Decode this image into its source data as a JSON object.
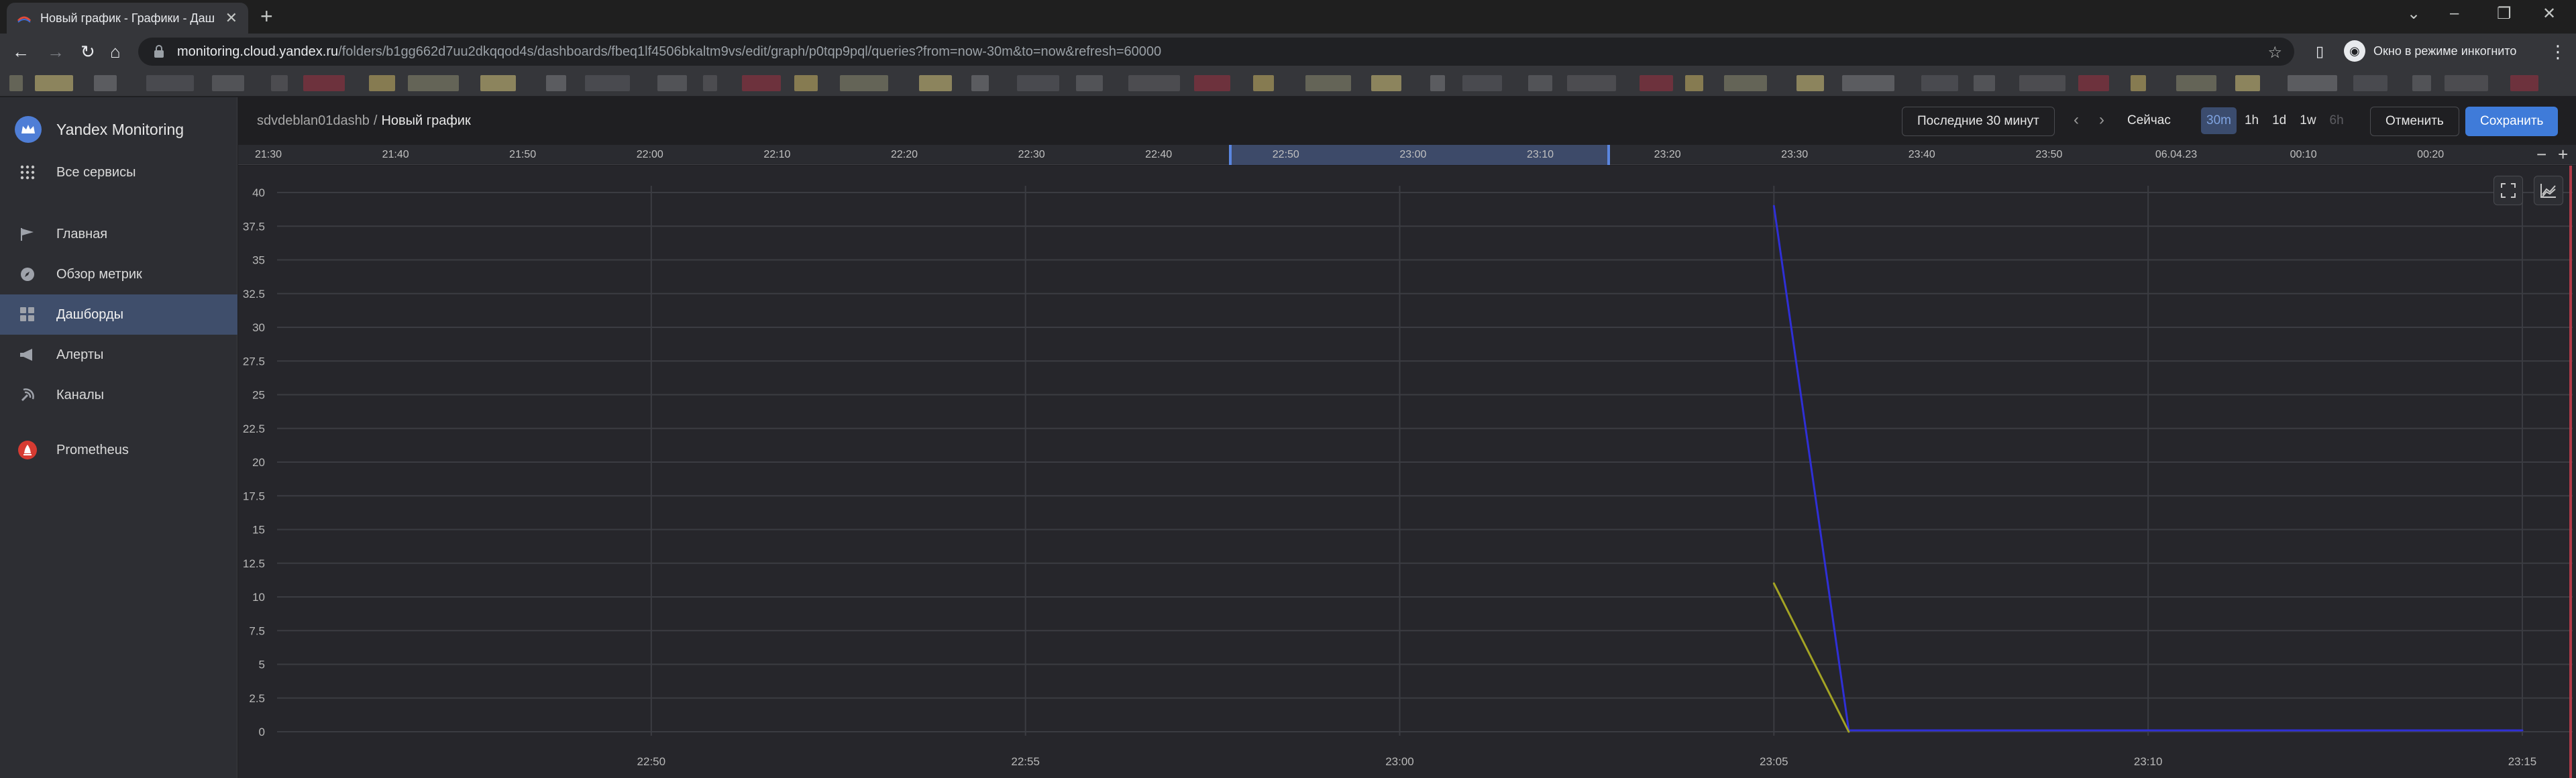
{
  "browser": {
    "tab_title": "Новый график - Графики - Даш",
    "url_host": "monitoring.cloud.yandex.ru",
    "url_path": "/folders/b1gg662d7uu2dkqqod4s/dashboards/fbeq1lf4506bkaltm9vs/edit/graph/p0tqp9pql/queries?from=now-30m&to=now&refresh=60000",
    "incognito_label": "Окно в режиме инкогнито"
  },
  "sidebar": {
    "brand": "Yandex Monitoring",
    "all_services": "Все сервисы",
    "items": [
      {
        "label": "Главная",
        "icon": "flag-icon"
      },
      {
        "label": "Обзор метрик",
        "icon": "compass-icon"
      },
      {
        "label": "Дашборды",
        "icon": "dashboard-icon",
        "active": true
      },
      {
        "label": "Алерты",
        "icon": "megaphone-icon"
      },
      {
        "label": "Каналы",
        "icon": "channels-icon"
      }
    ],
    "prometheus": "Prometheus"
  },
  "header": {
    "breadcrumb_parent": "sdvdeblan01dashb",
    "breadcrumb_sep": "/",
    "breadcrumb_current": "Новый график",
    "time_range": "Последние 30 минут",
    "now_button": "Сейчас",
    "scales": [
      "30m",
      "1h",
      "1d",
      "1w",
      "6h"
    ],
    "selected_scale": "30m",
    "cancel_button": "Отменить",
    "save_button": "Сохранить"
  },
  "timenav": {
    "ticks": [
      "21:30",
      "21:40",
      "21:50",
      "22:00",
      "22:10",
      "22:20",
      "22:30",
      "22:40",
      "22:50",
      "23:00",
      "23:10",
      "23:20",
      "23:30",
      "23:40",
      "23:50",
      "06.04.23",
      "00:10",
      "00:20"
    ],
    "zoom_out": "−",
    "zoom_in": "+"
  },
  "chart_data": {
    "type": "line",
    "x_ticks": [
      "22:50",
      "22:55",
      "23:00",
      "23:05",
      "23:10",
      "23:15"
    ],
    "y_ticks": [
      "0",
      "2.5",
      "5",
      "7.5",
      "10",
      "12.5",
      "15",
      "17.5",
      "20",
      "22.5",
      "25",
      "27.5",
      "30",
      "32.5",
      "35",
      "37.5",
      "40"
    ],
    "ylim": [
      0,
      40
    ],
    "grid": true,
    "series": [
      {
        "color": "#2f2fd6",
        "x": [
          "23:05",
          "23:06",
          "23:10",
          "23:15"
        ],
        "values": [
          39.0,
          0.1,
          0.1,
          0.1
        ]
      },
      {
        "color": "#a3a324",
        "x": [
          "23:05",
          "23:06"
        ],
        "values": [
          11.0,
          0.0
        ]
      }
    ]
  }
}
